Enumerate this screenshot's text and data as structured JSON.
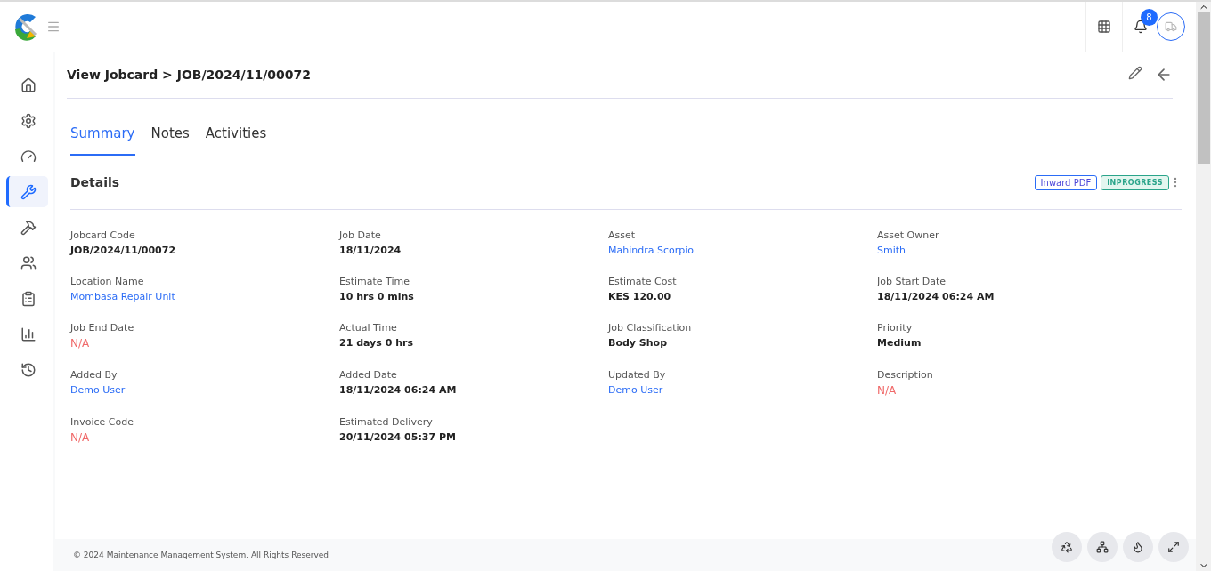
{
  "header": {
    "notifications": "8"
  },
  "sidebar": {
    "items": [
      {
        "kind": "home",
        "selected": false
      },
      {
        "kind": "settings",
        "selected": false
      },
      {
        "kind": "gauge",
        "selected": false
      },
      {
        "kind": "tools",
        "selected": true
      },
      {
        "kind": "wrench",
        "selected": false
      },
      {
        "kind": "team",
        "selected": false
      },
      {
        "kind": "clipboard",
        "selected": false
      },
      {
        "kind": "chart",
        "selected": false
      },
      {
        "kind": "history",
        "selected": false
      }
    ]
  },
  "page": {
    "title": "View Jobcard > JOB/2024/11/00072"
  },
  "tabs": [
    {
      "label": "Summary",
      "selected": true
    },
    {
      "label": "Notes",
      "selected": false
    },
    {
      "label": "Activities",
      "selected": false
    }
  ],
  "details": {
    "title": "Details",
    "pdf_button": "Inward PDF",
    "status": "INPROGRESS",
    "fields": [
      {
        "label": "Jobcard Code",
        "value": "JOB/2024/11/00072",
        "kind": "plain"
      },
      {
        "label": "Job Date",
        "value": "18/11/2024",
        "kind": "plain"
      },
      {
        "label": "Asset",
        "value": "Mahindra Scorpio",
        "kind": "link"
      },
      {
        "label": "Asset Owner",
        "value": "Smith",
        "kind": "link"
      },
      {
        "label": "Location Name",
        "value": "Mombasa Repair Unit",
        "kind": "link"
      },
      {
        "label": "Estimate Time",
        "value": "10 hrs 0 mins",
        "kind": "plain"
      },
      {
        "label": "Estimate Cost",
        "value": "KES 120.00",
        "kind": "plain"
      },
      {
        "label": "Job Start Date",
        "value": "18/11/2024 06:24 AM",
        "kind": "plain"
      },
      {
        "label": "Job End Date",
        "value": "N/A",
        "kind": "na"
      },
      {
        "label": "Actual Time",
        "value": "21 days 0 hrs",
        "kind": "plain"
      },
      {
        "label": "Job Classification",
        "value": "Body Shop",
        "kind": "plain"
      },
      {
        "label": "Priority",
        "value": "Medium",
        "kind": "plain"
      },
      {
        "label": "Added By",
        "value": "Demo User",
        "kind": "link"
      },
      {
        "label": "Added Date",
        "value": "18/11/2024 06:24 AM",
        "kind": "plain"
      },
      {
        "label": "Updated By",
        "value": "Demo User",
        "kind": "link"
      },
      {
        "label": "Description",
        "value": "N/A",
        "kind": "na"
      },
      {
        "label": "Invoice Code",
        "value": "N/A",
        "kind": "na"
      },
      {
        "label": "Estimated Delivery",
        "value": "20/11/2024 05:37 PM",
        "kind": "plain"
      }
    ]
  },
  "footer": {
    "text": "© 2024 Maintenance Management System. All Rights Reserved"
  },
  "floating_buttons": [
    {
      "kind": "recycle"
    },
    {
      "kind": "network"
    },
    {
      "kind": "flame"
    },
    {
      "kind": "expand"
    }
  ]
}
